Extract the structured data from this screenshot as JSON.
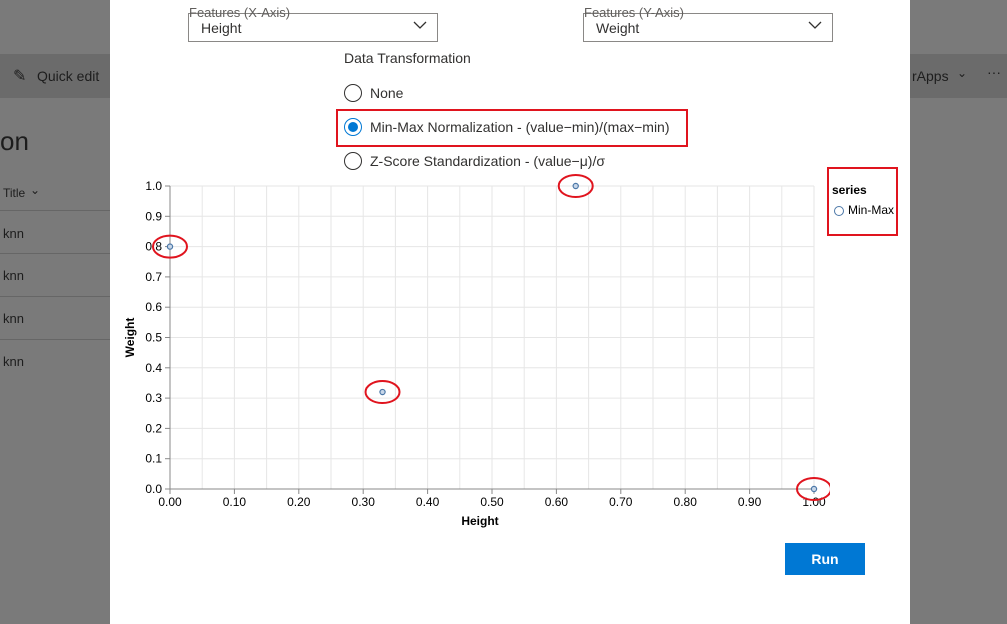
{
  "background": {
    "toolbar_quick_edit": "Quick edit",
    "toolbar_right": "rApps",
    "toolbar_more": "···",
    "page_title_fragment": "on",
    "column_header": "Title",
    "rows": [
      "knn",
      "knn",
      "knn",
      "knn"
    ]
  },
  "dialog": {
    "x_feature": {
      "label": "Features (X-Axis)",
      "value": "Height"
    },
    "y_feature": {
      "label": "Features (Y-Axis)",
      "value": "Weight"
    },
    "transformation_title": "Data Transformation",
    "options": [
      {
        "label": "None",
        "checked": false
      },
      {
        "label": "Min-Max Normalization - (value−min)/(max−min)",
        "checked": true
      },
      {
        "label": "Z-Score Standardization - (value−μ)/σ",
        "checked": false
      }
    ],
    "run_label": "Run",
    "accent_color": "#0078d4",
    "highlight_color": "#e0141e"
  },
  "chart_data": {
    "type": "scatter",
    "xlabel": "Height",
    "ylabel": "Weight",
    "xlim": [
      0,
      1
    ],
    "ylim": [
      0,
      1
    ],
    "x_ticks": [
      "0.00",
      "0.10",
      "0.20",
      "0.30",
      "0.40",
      "0.50",
      "0.60",
      "0.70",
      "0.80",
      "0.90",
      "1.00"
    ],
    "y_ticks": [
      "0.0",
      "0.1",
      "0.2",
      "0.3",
      "0.4",
      "0.5",
      "0.6",
      "0.7",
      "0.8",
      "0.9",
      "1.0"
    ],
    "grid": true,
    "legend_title": "series",
    "legend_placement": "right",
    "series": [
      {
        "name": "Min-Max",
        "color": "#4c78a8",
        "points": [
          {
            "x": 0.0,
            "y": 0.8
          },
          {
            "x": 0.33,
            "y": 0.32
          },
          {
            "x": 0.63,
            "y": 1.0
          },
          {
            "x": 1.0,
            "y": 0.0
          }
        ]
      }
    ]
  }
}
